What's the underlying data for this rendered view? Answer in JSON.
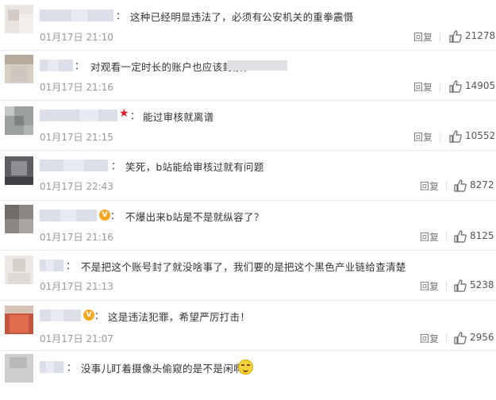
{
  "comments": [
    {
      "text": "这种已经明显违法了，必须有公安机关的重拳震慑",
      "time": "01月17日 21:10",
      "reply": "回复",
      "likes": "21278"
    },
    {
      "text": "对观看一定时长的账户也应该封禁，",
      "time": "01月17日 21:16",
      "reply": "回复",
      "likes": "14905"
    },
    {
      "text": "能过审核就离谱",
      "time": "01月17日 21:15",
      "reply": "回复",
      "likes": "10552"
    },
    {
      "text": "笑死，b站能给审核过就有问题",
      "time": "01月17日 22:43",
      "reply": "回复",
      "likes": "8272"
    },
    {
      "text": "不爆出来b站是不是就纵容了？",
      "time": "01月17日 21:16",
      "reply": "回复",
      "likes": "8125"
    },
    {
      "text": "不是把这个账号封了就没啥事了，我们要的是把这个黑色产业链给查清楚",
      "time": "01月17日 21:13",
      "reply": "回复",
      "likes": "5238"
    },
    {
      "text": "这是违法犯罪，希望严厉打击！",
      "time": "01月17日 21:07",
      "reply": "回复",
      "likes": "2956"
    },
    {
      "text": "没事儿盯着摄像头偷窥的是不是闲啊",
      "time": "",
      "reply": "",
      "likes": ""
    }
  ],
  "icons": {
    "like": "thumbs-up-icon",
    "verified": "verified-v-icon",
    "star": "red-star-icon",
    "emoji": "wink-emoji-icon"
  },
  "colors": {
    "text": "#333333",
    "meta": "#999999",
    "verified": "#f5a623",
    "star": "#e02020"
  },
  "verified_mark": "V",
  "star_mark": "★",
  "colon": "："
}
